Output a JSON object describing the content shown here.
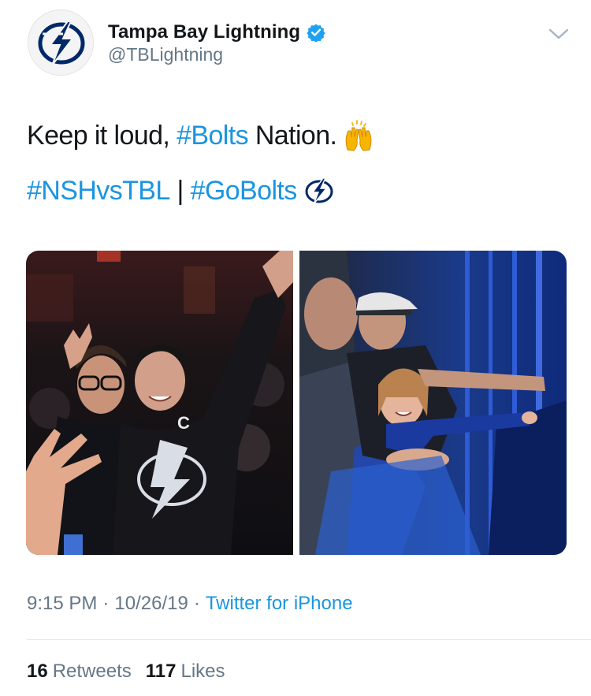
{
  "header": {
    "display_name": "Tampa Bay Lightning",
    "handle": "@TBLightning",
    "avatar_icon": "lightning-logo-icon",
    "verified_icon": "verified-badge-icon",
    "menu_icon": "chevron-down-icon"
  },
  "tweet": {
    "line1": {
      "text_before": "Keep it loud, ",
      "hashtag": "#Bolts",
      "text_after": " Nation.",
      "emoji": "raising-hands-icon"
    },
    "line2": {
      "hashtag1": "#NSHvsTBL",
      "separator": " | ",
      "hashtag2": "#GoBolts",
      "emoji": "bolt-hashflag-icon"
    }
  },
  "media": {
    "photos": [
      {
        "name": "fans-photo-left",
        "description_icon": "photo-icon"
      },
      {
        "name": "fans-photo-right",
        "description_icon": "photo-icon"
      }
    ]
  },
  "meta": {
    "time": "9:15 PM",
    "dot1": "·",
    "date": "10/26/19",
    "dot2": "·",
    "source": "Twitter for iPhone"
  },
  "stats": {
    "retweets_count": "16",
    "retweets_label": "Retweets",
    "likes_count": "117",
    "likes_label": "Likes"
  },
  "colors": {
    "link": "#1b95e0",
    "text": "#14171a",
    "muted": "#657786",
    "divider": "#e1e8ed",
    "verified": "#1da1f2"
  }
}
